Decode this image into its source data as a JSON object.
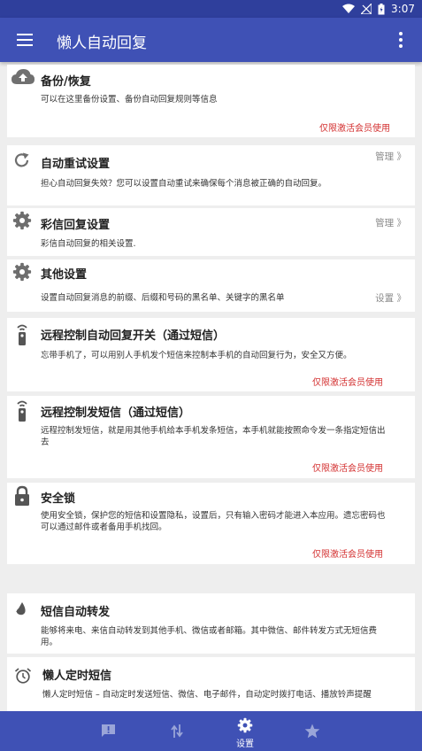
{
  "status": {
    "time": "3:07"
  },
  "appbar": {
    "title": "懒人自动回复"
  },
  "cards": [
    {
      "title": "备份/恢复",
      "desc": "可以在这里备份设置、备份自动回复规则等信息",
      "member": "仅限激活会员使用"
    },
    {
      "title": "自动重试设置",
      "desc": "担心自动回复失效？您可以设置自动重试来确保每个消息被正确的自动回复。",
      "action": "管理 》"
    },
    {
      "title": "彩信回复设置",
      "desc": "彩信自动回复的相关设置.",
      "action": "管理 》"
    },
    {
      "title": "其他设置",
      "desc": "设置自动回复消息的前缀、后缀和号码的黑名单、关键字的黑名单",
      "action": "设置 》"
    },
    {
      "title": "远程控制自动回复开关（通过短信）",
      "desc": "忘带手机了，可以用别人手机发个短信来控制本手机的自动回复行为，安全又方便。",
      "member": "仅限激活会员使用"
    },
    {
      "title": "远程控制发短信（通过短信）",
      "desc": "远程控制发短信，就是用其他手机给本手机发条短信，本手机就能按照命令发一条指定短信出去",
      "member": "仅限激活会员使用"
    },
    {
      "title": "安全锁",
      "desc": "使用安全锁，保护您的短信和设置隐私，设置后，只有输入密码才能进入本应用。遗忘密码也可以通过邮件或者备用手机找回。",
      "member": "仅限激活会员使用"
    },
    {
      "title": "短信自动转发",
      "desc": "能够将来电、来信自动转发到其他手机、微信或者邮箱。其中微信、邮件转发方式无短信费用。"
    },
    {
      "title": "懒人定时短信",
      "desc": "懒人定时短信 – 自动定时发送短信、微信、电子邮件，自动定时拨打电话、播放铃声提醒"
    }
  ],
  "bottomnav": {
    "settings_label": "设置"
  },
  "colors": {
    "primary": "#3f51b5",
    "statusbar": "#2f3f9c",
    "member_red": "#d32f2f"
  },
  "icons": [
    "wifi-icon",
    "signal-icon",
    "battery-icon",
    "menu-icon",
    "more-vert-icon",
    "cloud-upload-icon",
    "refresh-icon",
    "gear-icon",
    "remote-control-icon",
    "lock-icon",
    "forward-drop-icon",
    "alarm-clock-icon",
    "feedback-icon",
    "swap-vert-icon",
    "star-icon"
  ]
}
